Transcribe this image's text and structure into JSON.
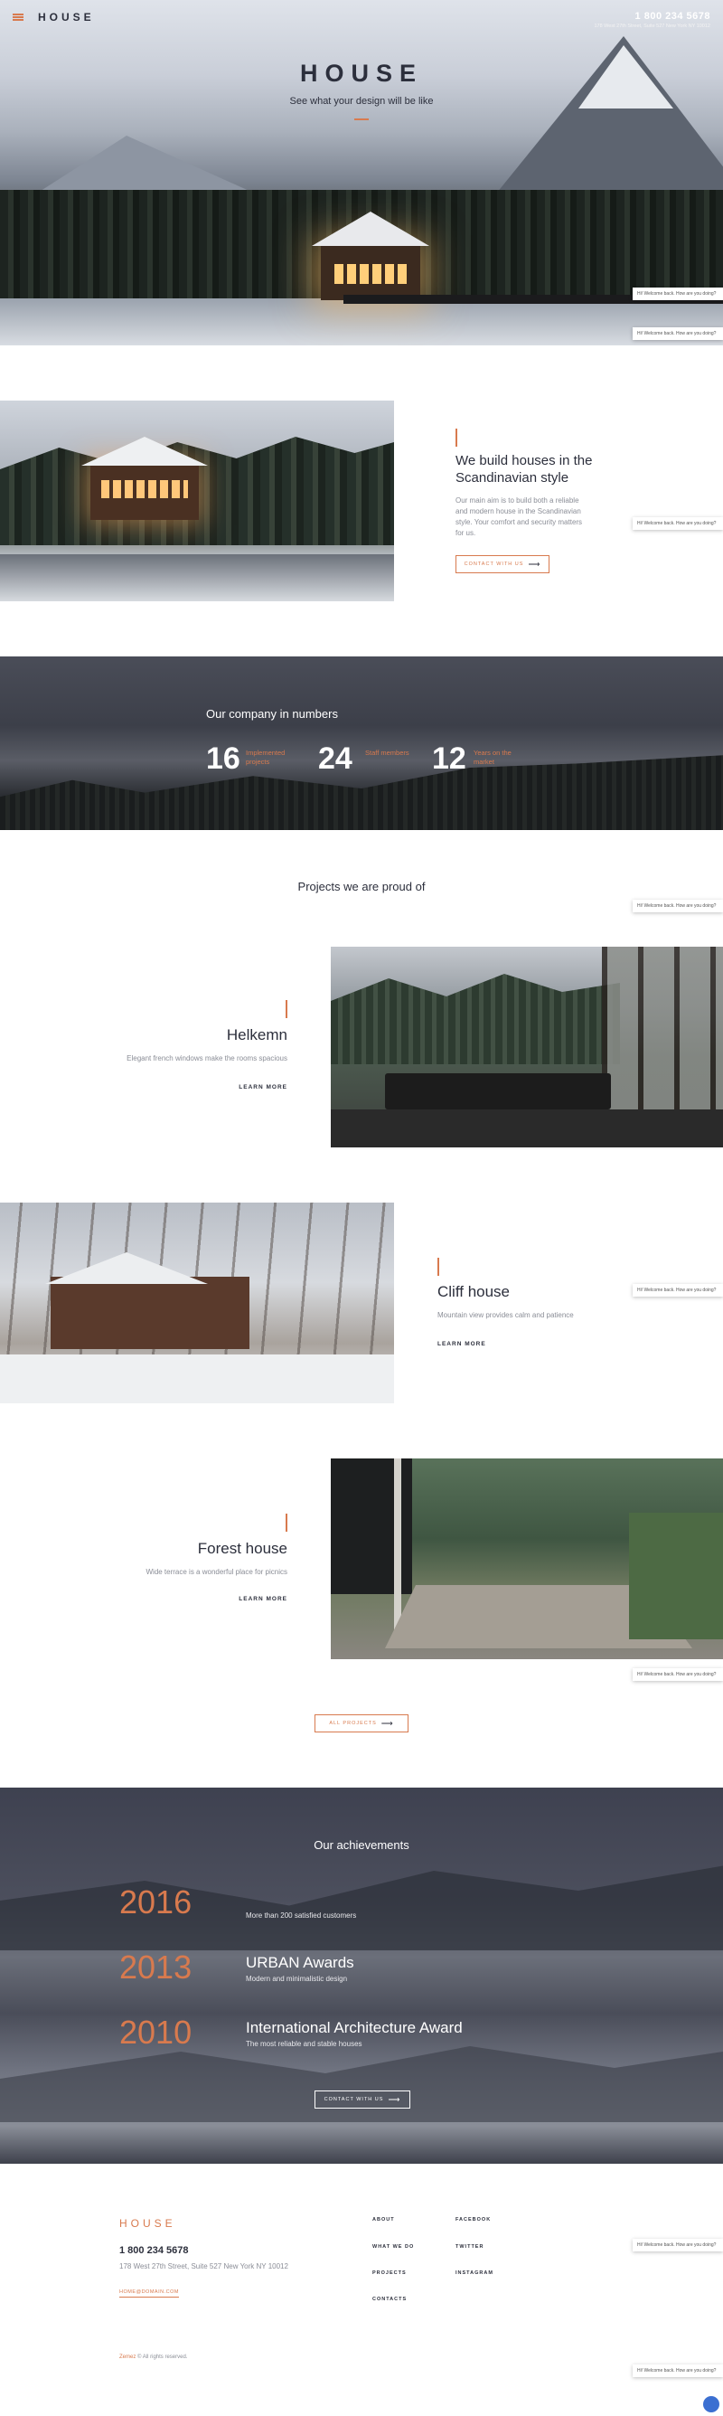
{
  "header": {
    "logo": "HOUSE",
    "phone": "1 800 234 5678",
    "address": "178 West 27th Street, Suite 527 New York NY 10012"
  },
  "hero": {
    "title": "HOUSE",
    "subtitle": "See what your design will be like"
  },
  "chat_widget": {
    "message": "Hi! Welcome back. How are you doing?"
  },
  "about": {
    "heading_line1": "We build houses in the",
    "heading_line2": "Scandinavian style",
    "text": "Our main aim is to build both a reliable and modern house in the Scandinavian style. Your comfort and security matters for us.",
    "button": "CONTACT WITH US"
  },
  "numbers": {
    "title": "Our company in numbers",
    "items": [
      {
        "value": "16",
        "label": "Implemented projects"
      },
      {
        "value": "24",
        "label": "Staff members"
      },
      {
        "value": "12",
        "label": "Years on the market"
      }
    ]
  },
  "projects": {
    "title": "Projects we are proud of",
    "items": [
      {
        "name": "Helkemn",
        "text": "Elegant french windows make the rooms spacious",
        "link": "LEARN MORE"
      },
      {
        "name": "Cliff house",
        "text": "Mountain view provides calm and patience",
        "link": "LEARN MORE"
      },
      {
        "name": "Forest house",
        "text": "Wide terrace is a wonderful place for picnics",
        "link": "LEARN MORE"
      }
    ],
    "all_button": "ALL PROJECTS"
  },
  "achievements": {
    "title": "Our achievements",
    "items": [
      {
        "year": "2016",
        "title": "",
        "text": "More than 200 satisfied customers"
      },
      {
        "year": "2013",
        "title": "URBAN Awards",
        "text": "Modern and minimalistic design"
      },
      {
        "year": "2010",
        "title": "International Architecture Award",
        "text": "The most reliable and stable houses"
      }
    ],
    "button": "CONTACT WITH US"
  },
  "footer": {
    "logo": "HOUSE",
    "phone": "1 800 234 5678",
    "address": "178 West 27th Street, Suite 527 New York NY 10012",
    "email": "HOME@DOMAIN.COM",
    "nav": [
      "ABOUT",
      "WHAT WE DO",
      "PROJECTS",
      "CONTACTS"
    ],
    "social": [
      "FACEBOOK",
      "TWITTER",
      "INSTAGRAM"
    ],
    "copyright_brand": "Zemez",
    "copyright": "© All rights reserved."
  },
  "colors": {
    "accent": "#d87a4e",
    "dark": "#2c2f3c",
    "muted": "#8a8d96"
  }
}
